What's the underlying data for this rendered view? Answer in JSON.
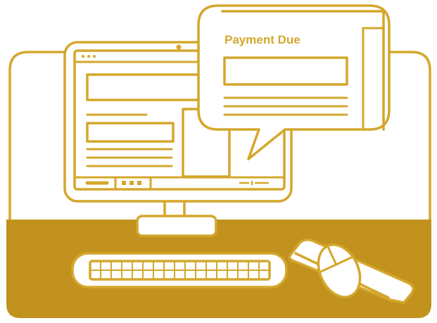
{
  "callout": {
    "title": "Payment Due"
  },
  "colors": {
    "accent": "#D4A72C",
    "desk": "#C2921E",
    "background": "#ffffff"
  },
  "icons": [
    "monitor-icon",
    "keyboard-icon",
    "mouse-icon",
    "mousepad-icon",
    "speech-bubble-icon"
  ]
}
